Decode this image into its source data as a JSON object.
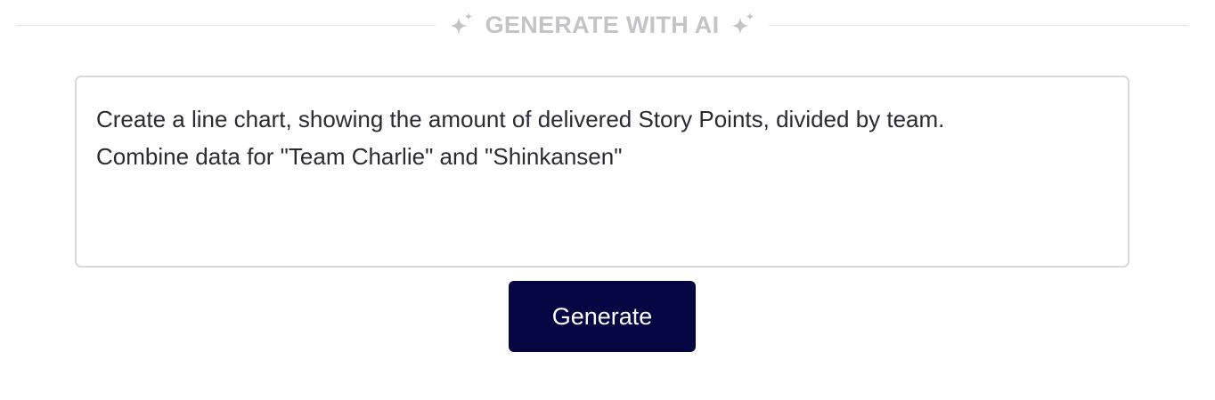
{
  "section": {
    "title": "GENERATE WITH AI",
    "left_icon": "sparkle-icon",
    "right_icon": "sparkle-icon"
  },
  "prompt": {
    "value": "Create a line chart, showing the amount of delivered Story Points, divided by team.\nCombine data for \"Team Charlie\" and \"Shinkansen\""
  },
  "actions": {
    "generate_label": "Generate"
  },
  "colors": {
    "button_bg": "#050543",
    "muted_text": "#c4c4c7",
    "border": "#d9d9dd",
    "body_text": "#2a2a33"
  }
}
